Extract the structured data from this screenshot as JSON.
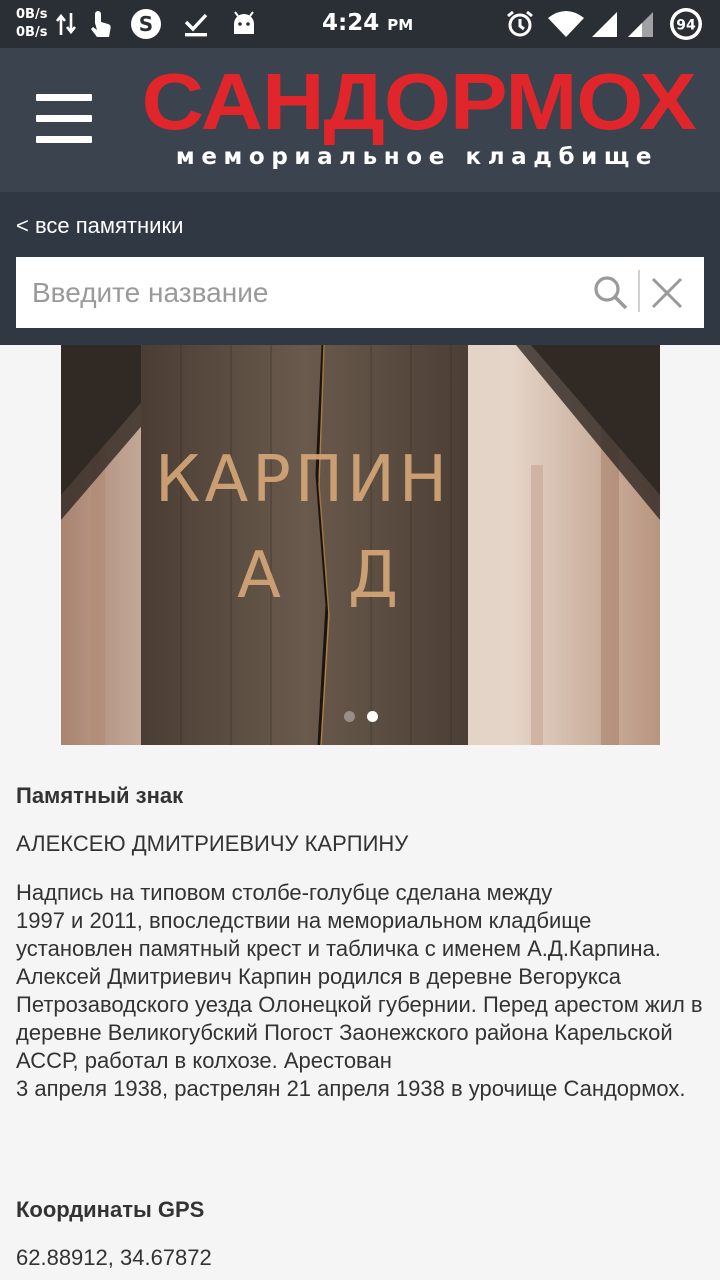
{
  "status_bar": {
    "net_up": "0B/s",
    "net_down": "0B/s",
    "time": "4:24",
    "ampm": "PM",
    "battery": "94",
    "icons": [
      "data-transfer-icon",
      "touch-icon",
      "skype-icon",
      "download-done-icon",
      "android-icon",
      "alarm-icon",
      "wifi-icon",
      "signal-icon",
      "signal-icon",
      "battery-icon"
    ]
  },
  "header": {
    "title": "САНДОРМОХ",
    "subtitle": "мемориальное кладбище",
    "title_color": "#e0262b"
  },
  "nav": {
    "back_label": "< все памятники"
  },
  "search": {
    "value": "",
    "placeholder": "Введите название"
  },
  "gallery": {
    "image": "wooden-post-inscription-karpin",
    "inscription": "КАРПИН А Д",
    "page_count": 2,
    "active_index": 1
  },
  "monument": {
    "type_label": "Памятный знак",
    "name": "АЛЕКСЕЮ ДМИТРИЕВИЧУ КАРПИНУ",
    "description_p1": "Надпись на типовом столбе-голубце сделана между\n1997 и 2011, впоследствии на мемориальном кладбище установлен памятный крест и табличка с именем А.Д.Карпина.",
    "description_p2": "Алексей Дмитриевич Карпин родился в деревне Вегорукса Петрозаводского уезда Олонецкой губернии. Перед арестом жил в деревне Великогубский Погост Заонежского района Карельской АССР, работал в колхозе. Арестован\n3 апреля 1938, растрелян 21 апреля 1938 в урочище Сандормох.",
    "gps_label": "Координаты GPS",
    "gps_value": "62.88912, 34.67872"
  }
}
